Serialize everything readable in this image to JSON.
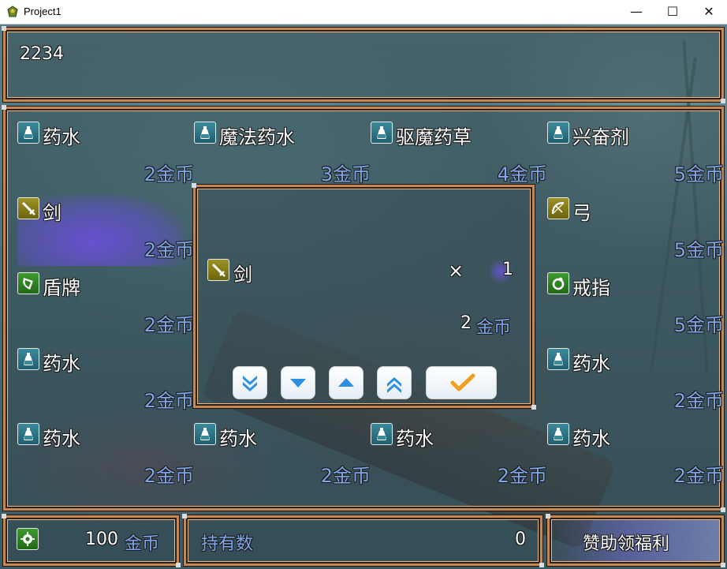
{
  "window": {
    "title": "Project1",
    "minimize": "—",
    "maximize": "☐",
    "close": "✕"
  },
  "help": {
    "text": "2234"
  },
  "items": [
    {
      "name": "药水",
      "price": "2金币",
      "icon": "potion-icon",
      "color": "teal"
    },
    {
      "name": "魔法药水",
      "price": "3金币",
      "icon": "potion-icon",
      "color": "teal"
    },
    {
      "name": "驱魔药草",
      "price": "4金币",
      "icon": "potion-icon",
      "color": "teal"
    },
    {
      "name": "兴奋剂",
      "price": "5金币",
      "icon": "potion-icon",
      "color": "teal"
    },
    {
      "name": "剑",
      "price": "2金币",
      "icon": "sword-icon",
      "color": "olive",
      "selected": true
    },
    {
      "name": "弓",
      "price": "5金币",
      "icon": "bow-icon",
      "color": "olive"
    },
    {
      "name": "盾牌",
      "price": "2金币",
      "icon": "shield-icon",
      "color": "green"
    },
    {
      "name": "戒指",
      "price": "5金币",
      "icon": "ring-icon",
      "color": "green"
    },
    {
      "name": "药水",
      "price": "2金币",
      "icon": "potion-icon",
      "color": "teal"
    },
    {
      "name": "药水",
      "price": "2金币",
      "icon": "potion-icon",
      "color": "teal"
    },
    {
      "name": "药水",
      "price": "2金币",
      "icon": "potion-icon",
      "color": "teal"
    },
    {
      "name": "药水",
      "price": "2金币",
      "icon": "potion-icon",
      "color": "teal"
    },
    {
      "name": "药水",
      "price": "2金币",
      "icon": "potion-icon",
      "color": "teal"
    },
    {
      "name": "药水",
      "price": "2金币",
      "icon": "potion-icon",
      "color": "teal"
    }
  ],
  "dialog": {
    "item_name": "剑",
    "item_icon": "sword-icon",
    "times": "×",
    "quantity": "1",
    "total_amount": "2",
    "total_unit": "金币",
    "buttons": [
      "quantity-down-10",
      "quantity-down-1",
      "quantity-up-1",
      "quantity-up-10",
      "confirm"
    ]
  },
  "gold": {
    "amount": "100",
    "unit": "金币",
    "icon": "gear-icon"
  },
  "possession": {
    "label": "持有数",
    "value": "0"
  },
  "sponsor": {
    "label": "赞助领福利"
  },
  "colors": {
    "frame": "#c78752",
    "price_blue": "#7fa6ea",
    "selection": "#6a55d6",
    "confirm": "#f0a01c"
  }
}
